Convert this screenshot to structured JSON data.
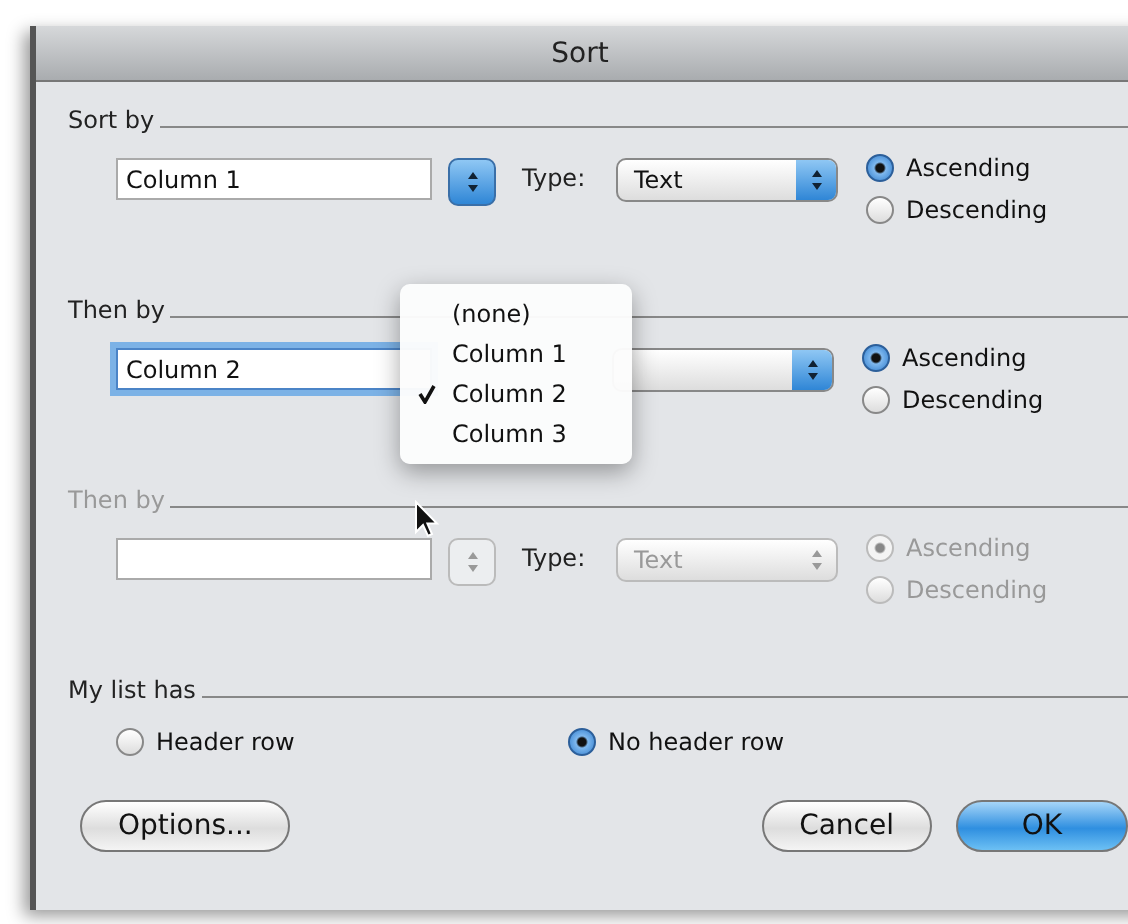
{
  "window": {
    "title": "Sort"
  },
  "sections": [
    {
      "label": "Sort by",
      "disabled": false,
      "field": {
        "value": "Column 1",
        "focused": false
      },
      "type_label": "Type:",
      "type_value": "Text",
      "orders": [
        {
          "label": "Ascending",
          "selected": true
        },
        {
          "label": "Descending",
          "selected": false
        }
      ]
    },
    {
      "label": "Then by",
      "disabled": false,
      "field": {
        "value": "Column 2",
        "focused": true
      },
      "orders": [
        {
          "label": "Ascending",
          "selected": true
        },
        {
          "label": "Descending",
          "selected": false
        }
      ]
    },
    {
      "label": "Then by",
      "disabled": true,
      "field": {
        "focused": false
      },
      "type_label": "Type:",
      "type_value": "Text",
      "orders": [
        {
          "label": "Ascending",
          "selected": true
        },
        {
          "label": "Descending",
          "selected": false
        }
      ]
    }
  ],
  "header": {
    "label": "My list has",
    "options": [
      {
        "label": "Header row",
        "selected": false
      },
      {
        "label": "No header row",
        "selected": true
      }
    ]
  },
  "menu": {
    "items": [
      {
        "label": "(none)",
        "selected": false
      },
      {
        "label": "Column 1",
        "selected": false
      },
      {
        "label": "Column 2",
        "selected": true
      },
      {
        "label": "Column 3",
        "selected": false
      }
    ]
  },
  "buttons": [
    {
      "label": "Options...",
      "kind": "normal"
    },
    {
      "label": "Cancel",
      "kind": "normal"
    },
    {
      "label": "OK",
      "kind": "default"
    }
  ]
}
